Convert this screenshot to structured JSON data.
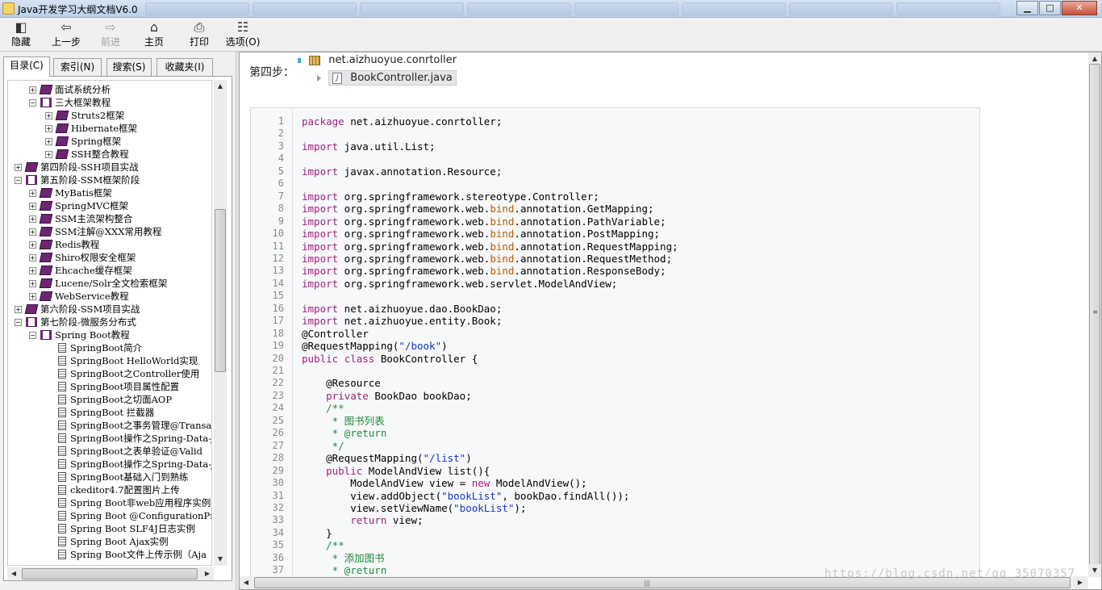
{
  "window": {
    "title": "Java开发学习大纲文档V6.0",
    "buttons": {
      "minimize": "▁",
      "maximize": "□",
      "close": "✕"
    }
  },
  "toolbar": {
    "hide": "隐藏",
    "back": "上一步",
    "forward": "前进",
    "home": "主页",
    "print": "打印",
    "options": "选项(O)"
  },
  "tabs": {
    "contents": "目录(C)",
    "index": "索引(N)",
    "search": "搜索(S)",
    "favorites": "收藏夹(I)"
  },
  "tree": {
    "items": [
      {
        "label": "面试系统分析",
        "level": 1,
        "type": "book-closed",
        "expander": "+"
      },
      {
        "label": "三大框架教程",
        "level": 1,
        "type": "book-open",
        "expander": "−"
      },
      {
        "label": "Struts2框架",
        "level": 2,
        "type": "book-closed",
        "expander": "+"
      },
      {
        "label": "Hibernate框架",
        "level": 2,
        "type": "book-closed",
        "expander": "+"
      },
      {
        "label": "Spring框架",
        "level": 2,
        "type": "book-closed",
        "expander": "+"
      },
      {
        "label": "SSH整合教程",
        "level": 2,
        "type": "book-closed",
        "expander": "+"
      },
      {
        "label": "第四阶段-SSH项目实战",
        "level": 0,
        "type": "book-closed",
        "expander": "+"
      },
      {
        "label": "第五阶段-SSM框架阶段",
        "level": 0,
        "type": "book-open",
        "expander": "−"
      },
      {
        "label": "MyBatis框架",
        "level": 1,
        "type": "book-closed",
        "expander": "+"
      },
      {
        "label": "SpringMVC框架",
        "level": 1,
        "type": "book-closed",
        "expander": "+"
      },
      {
        "label": "SSM主流架构整合",
        "level": 1,
        "type": "book-closed",
        "expander": "+"
      },
      {
        "label": "SSM注解@XXX常用教程",
        "level": 1,
        "type": "book-closed",
        "expander": "+"
      },
      {
        "label": "Redis教程",
        "level": 1,
        "type": "book-closed",
        "expander": "+"
      },
      {
        "label": "Shiro权限安全框架",
        "level": 1,
        "type": "book-closed",
        "expander": "+"
      },
      {
        "label": "Ehcache缓存框架",
        "level": 1,
        "type": "book-closed",
        "expander": "+"
      },
      {
        "label": "Lucene/Solr全文检索框架",
        "level": 1,
        "type": "book-closed",
        "expander": "+"
      },
      {
        "label": "WebService教程",
        "level": 1,
        "type": "book-closed",
        "expander": "+"
      },
      {
        "label": "第六阶段-SSM项目实战",
        "level": 0,
        "type": "book-closed",
        "expander": "+"
      },
      {
        "label": "第七阶段-微服务分布式",
        "level": 0,
        "type": "book-open",
        "expander": "−"
      },
      {
        "label": "Spring Boot教程",
        "level": 1,
        "type": "book-open",
        "expander": "−"
      },
      {
        "label": "SpringBoot简介",
        "level": 2,
        "type": "page",
        "expander": ""
      },
      {
        "label": "SpringBoot HelloWorld实现",
        "level": 2,
        "type": "page",
        "expander": ""
      },
      {
        "label": "SpringBoot之Controller使用",
        "level": 2,
        "type": "page",
        "expander": ""
      },
      {
        "label": "SpringBoot项目属性配置",
        "level": 2,
        "type": "page",
        "expander": ""
      },
      {
        "label": "SpringBoot之切面AOP",
        "level": 2,
        "type": "page",
        "expander": ""
      },
      {
        "label": "SpringBoot 拦截器",
        "level": 2,
        "type": "page",
        "expander": ""
      },
      {
        "label": "SpringBoot之事务管理@Transact",
        "level": 2,
        "type": "page",
        "expander": ""
      },
      {
        "label": "SpringBoot操作之Spring-Data-J",
        "level": 2,
        "type": "page",
        "expander": ""
      },
      {
        "label": "SpringBoot之表单验证@Valid",
        "level": 2,
        "type": "page",
        "expander": ""
      },
      {
        "label": "SpringBoot操作之Spring-Data-J",
        "level": 2,
        "type": "page",
        "expander": ""
      },
      {
        "label": "SpringBoot基础入门到熟练",
        "level": 2,
        "type": "page",
        "expander": ""
      },
      {
        "label": "ckeditor4.7配置图片上传",
        "level": 2,
        "type": "page",
        "expander": ""
      },
      {
        "label": "Spring Boot非web应用程序实例",
        "level": 2,
        "type": "page",
        "expander": ""
      },
      {
        "label": "Spring Boot @ConfigurationPro",
        "level": 2,
        "type": "page",
        "expander": ""
      },
      {
        "label": "Spring Boot SLF4J日志实例",
        "level": 2,
        "type": "page",
        "expander": ""
      },
      {
        "label": "Spring Boot Ajax实例",
        "level": 2,
        "type": "page",
        "expander": ""
      },
      {
        "label": "Spring Boot文件上传示例（Aja",
        "level": 2,
        "type": "page",
        "expander": ""
      }
    ]
  },
  "content": {
    "step_label": "第四步：",
    "package_name": "net.aizhuoyue.conrtoller",
    "file_name": "BookController.java",
    "code_lines": [
      [
        {
          "t": "package",
          "c": "kw"
        },
        {
          "t": " net.aizhuoyue.conrtoller;"
        }
      ],
      [],
      [
        {
          "t": "import",
          "c": "kw"
        },
        {
          "t": " java.util.List;"
        }
      ],
      [],
      [
        {
          "t": "import",
          "c": "kw"
        },
        {
          "t": " javax.annotation.Resource;"
        }
      ],
      [],
      [
        {
          "t": "import",
          "c": "kw"
        },
        {
          "t": " org.springframework.stereotype.Controller;"
        }
      ],
      [
        {
          "t": "import",
          "c": "kw"
        },
        {
          "t": " org.springframework.web."
        },
        {
          "t": "bind",
          "c": "hl"
        },
        {
          "t": ".annotation.GetMapping;"
        }
      ],
      [
        {
          "t": "import",
          "c": "kw"
        },
        {
          "t": " org.springframework.web."
        },
        {
          "t": "bind",
          "c": "hl"
        },
        {
          "t": ".annotation.PathVariable;"
        }
      ],
      [
        {
          "t": "import",
          "c": "kw"
        },
        {
          "t": " org.springframework.web."
        },
        {
          "t": "bind",
          "c": "hl"
        },
        {
          "t": ".annotation.PostMapping;"
        }
      ],
      [
        {
          "t": "import",
          "c": "kw"
        },
        {
          "t": " org.springframework.web."
        },
        {
          "t": "bind",
          "c": "hl"
        },
        {
          "t": ".annotation.RequestMapping;"
        }
      ],
      [
        {
          "t": "import",
          "c": "kw"
        },
        {
          "t": " org.springframework.web."
        },
        {
          "t": "bind",
          "c": "hl"
        },
        {
          "t": ".annotation.RequestMethod;"
        }
      ],
      [
        {
          "t": "import",
          "c": "kw"
        },
        {
          "t": " org.springframework.web."
        },
        {
          "t": "bind",
          "c": "hl"
        },
        {
          "t": ".annotation.ResponseBody;"
        }
      ],
      [
        {
          "t": "import",
          "c": "kw"
        },
        {
          "t": " org.springframework.web.servlet.ModelAndView;"
        }
      ],
      [],
      [
        {
          "t": "import",
          "c": "kw"
        },
        {
          "t": " net.aizhuoyue.dao.BookDao;"
        }
      ],
      [
        {
          "t": "import",
          "c": "kw"
        },
        {
          "t": " net.aizhuoyue.entity.Book;"
        }
      ],
      [
        {
          "t": "@Controller"
        }
      ],
      [
        {
          "t": "@RequestMapping("
        },
        {
          "t": "\"/book\"",
          "c": "st"
        },
        {
          "t": ")"
        }
      ],
      [
        {
          "t": "public",
          "c": "kw"
        },
        {
          "t": " "
        },
        {
          "t": "class",
          "c": "kw"
        },
        {
          "t": " BookController {"
        }
      ],
      [],
      [
        {
          "t": "    @Resource"
        }
      ],
      [
        {
          "t": "    "
        },
        {
          "t": "private",
          "c": "kw"
        },
        {
          "t": " BookDao bookDao;"
        }
      ],
      [
        {
          "t": "    /**",
          "c": "cm"
        }
      ],
      [
        {
          "t": "     * 图书列表",
          "c": "cm"
        }
      ],
      [
        {
          "t": "     * @return",
          "c": "cm"
        }
      ],
      [
        {
          "t": "     */",
          "c": "cm"
        }
      ],
      [
        {
          "t": "    @RequestMapping("
        },
        {
          "t": "\"/list\"",
          "c": "st"
        },
        {
          "t": ")"
        }
      ],
      [
        {
          "t": "    "
        },
        {
          "t": "public",
          "c": "kw"
        },
        {
          "t": " ModelAndView list(){"
        }
      ],
      [
        {
          "t": "        ModelAndView view = "
        },
        {
          "t": "new",
          "c": "kw"
        },
        {
          "t": " ModelAndView();"
        }
      ],
      [
        {
          "t": "        view.addObject("
        },
        {
          "t": "\"bookList\"",
          "c": "st"
        },
        {
          "t": ", bookDao.findAll());"
        }
      ],
      [
        {
          "t": "        view.setViewName("
        },
        {
          "t": "\"bookList\"",
          "c": "st"
        },
        {
          "t": ");"
        }
      ],
      [
        {
          "t": "        "
        },
        {
          "t": "return",
          "c": "kw"
        },
        {
          "t": " view;"
        }
      ],
      [
        {
          "t": "    }"
        }
      ],
      [
        {
          "t": "    /**",
          "c": "cm"
        }
      ],
      [
        {
          "t": "     * 添加图书",
          "c": "cm"
        }
      ],
      [
        {
          "t": "     * @return",
          "c": "cm"
        }
      ]
    ]
  },
  "watermark": "https://blog.csdn.net/qq_35070357",
  "colors": {
    "keyword": "#a31f7a",
    "highlight": "#c05a00",
    "string": "#1a35c9",
    "comment": "#1f8a3b"
  }
}
